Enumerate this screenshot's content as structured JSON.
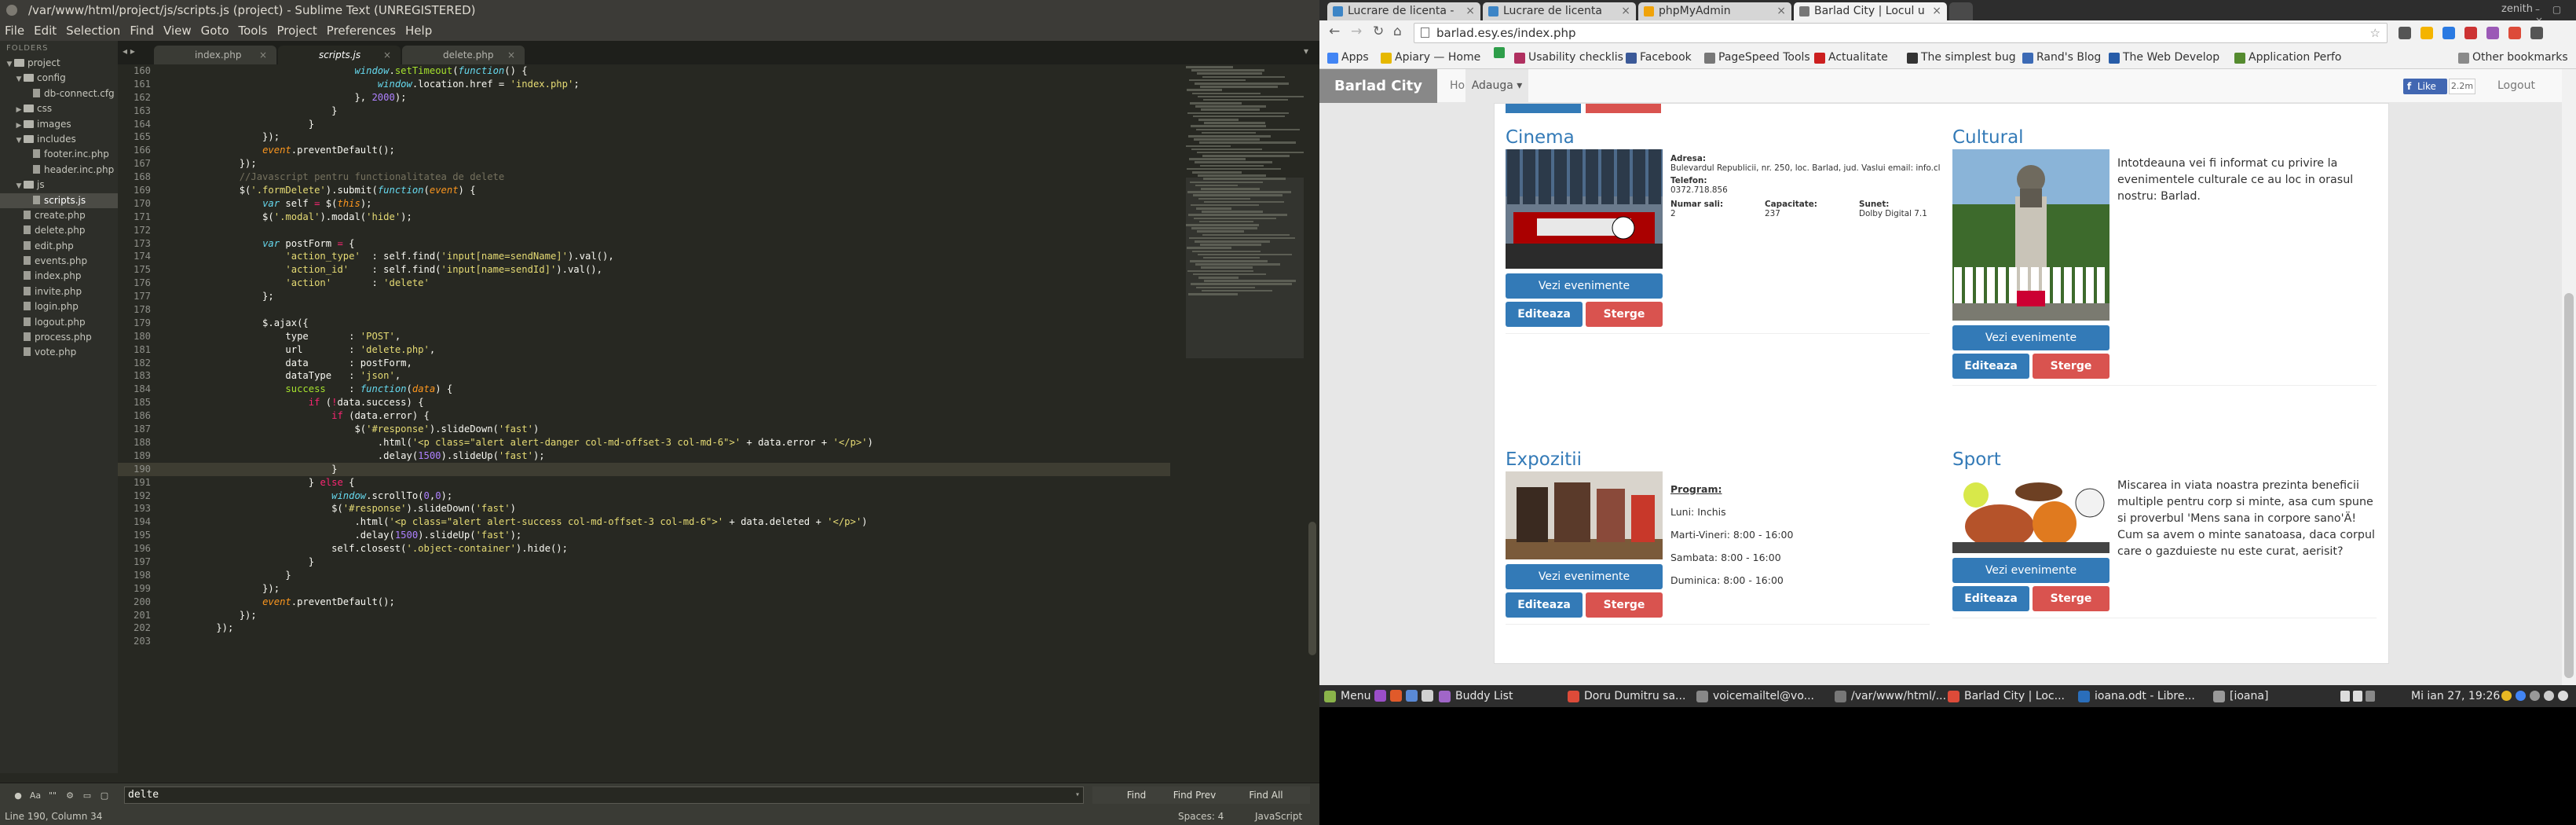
{
  "sublime": {
    "title": "/var/www/html/project/js/scripts.js (project) - Sublime Text (UNREGISTERED)",
    "menu": [
      "File",
      "Edit",
      "Selection",
      "Find",
      "View",
      "Goto",
      "Tools",
      "Project",
      "Preferences",
      "Help"
    ],
    "folders_label": "FOLDERS",
    "tree": [
      {
        "label": "project",
        "depth": 0,
        "kind": "folder",
        "open": true
      },
      {
        "label": "config",
        "depth": 1,
        "kind": "folder",
        "open": true
      },
      {
        "label": "db-connect.cfg",
        "depth": 2,
        "kind": "file"
      },
      {
        "label": "css",
        "depth": 1,
        "kind": "folder",
        "open": false
      },
      {
        "label": "images",
        "depth": 1,
        "kind": "folder",
        "open": false
      },
      {
        "label": "includes",
        "depth": 1,
        "kind": "folder",
        "open": true
      },
      {
        "label": "footer.inc.php",
        "depth": 2,
        "kind": "file"
      },
      {
        "label": "header.inc.php",
        "depth": 2,
        "kind": "file"
      },
      {
        "label": "js",
        "depth": 1,
        "kind": "folder",
        "open": true
      },
      {
        "label": "scripts.js",
        "depth": 2,
        "kind": "file",
        "selected": true
      },
      {
        "label": "create.php",
        "depth": 1,
        "kind": "file"
      },
      {
        "label": "delete.php",
        "depth": 1,
        "kind": "file"
      },
      {
        "label": "edit.php",
        "depth": 1,
        "kind": "file"
      },
      {
        "label": "events.php",
        "depth": 1,
        "kind": "file"
      },
      {
        "label": "index.php",
        "depth": 1,
        "kind": "file"
      },
      {
        "label": "invite.php",
        "depth": 1,
        "kind": "file"
      },
      {
        "label": "login.php",
        "depth": 1,
        "kind": "file"
      },
      {
        "label": "logout.php",
        "depth": 1,
        "kind": "file"
      },
      {
        "label": "process.php",
        "depth": 1,
        "kind": "file"
      },
      {
        "label": "vote.php",
        "depth": 1,
        "kind": "file"
      }
    ],
    "tabs": [
      {
        "label": "index.php"
      },
      {
        "label": "scripts.js",
        "active": true
      },
      {
        "label": "delete.php"
      }
    ],
    "tab_close": "×",
    "tab_nav": "◂ ▸",
    "tab_menu": "▾",
    "code": [
      {
        "n": "160",
        "t": [
          [
            "                            ",
            ""
          ],
          [
            "window",
            "fn"
          ],
          [
            ".",
            ""
          ],
          [
            "setTimeout",
            "id"
          ],
          [
            "(",
            ""
          ],
          [
            "function",
            "fn"
          ],
          [
            "() {",
            ""
          ]
        ]
      },
      {
        "n": "161",
        "t": [
          [
            "                                ",
            ""
          ],
          [
            "window",
            "fn"
          ],
          [
            ".location.href = ",
            ""
          ],
          [
            "'index.php'",
            "st"
          ],
          [
            ";",
            ""
          ]
        ]
      },
      {
        "n": "162",
        "t": [
          [
            "                            }, ",
            ""
          ],
          [
            "2000",
            "nu"
          ],
          [
            ");",
            ""
          ]
        ]
      },
      {
        "n": "163",
        "t": [
          [
            "                        }",
            ""
          ]
        ]
      },
      {
        "n": "164",
        "t": [
          [
            "                    }",
            ""
          ]
        ]
      },
      {
        "n": "165",
        "t": [
          [
            "            });",
            ""
          ]
        ]
      },
      {
        "n": "166",
        "t": [
          [
            "            ",
            ""
          ],
          [
            "event",
            "pa"
          ],
          [
            ".preventDefault();",
            ""
          ]
        ]
      },
      {
        "n": "167",
        "t": [
          [
            "        });",
            ""
          ]
        ]
      },
      {
        "n": "168",
        "t": [
          [
            "        ",
            ""
          ],
          [
            "//Javascript pentru functionalitatea de delete",
            "cm"
          ]
        ]
      },
      {
        "n": "169",
        "t": [
          [
            "        $(",
            ""
          ],
          [
            "'.formDelete'",
            "st"
          ],
          [
            ").submit(",
            ""
          ],
          [
            "function",
            "fn"
          ],
          [
            "(",
            ""
          ],
          [
            "event",
            "pa"
          ],
          [
            ") {",
            ""
          ]
        ]
      },
      {
        "n": "170",
        "t": [
          [
            "            ",
            ""
          ],
          [
            "var",
            "fn"
          ],
          [
            " self ",
            ""
          ],
          [
            "=",
            "kw"
          ],
          [
            " $(",
            ""
          ],
          [
            "this",
            "pa"
          ],
          [
            ");",
            ""
          ]
        ]
      },
      {
        "n": "171",
        "t": [
          [
            "            $(",
            ""
          ],
          [
            "'.modal'",
            "st"
          ],
          [
            ").modal(",
            ""
          ],
          [
            "'hide'",
            "st"
          ],
          [
            ");",
            ""
          ]
        ]
      },
      {
        "n": "172",
        "t": [
          [
            "",
            ""
          ]
        ]
      },
      {
        "n": "173",
        "t": [
          [
            "            ",
            ""
          ],
          [
            "var",
            "fn"
          ],
          [
            " postForm ",
            ""
          ],
          [
            "=",
            "kw"
          ],
          [
            " {",
            ""
          ]
        ]
      },
      {
        "n": "174",
        "t": [
          [
            "                ",
            ""
          ],
          [
            "'action_type'",
            "st"
          ],
          [
            "  : self.find(",
            ""
          ],
          [
            "'input[name=sendName]'",
            "st"
          ],
          [
            ").val(),",
            ""
          ]
        ]
      },
      {
        "n": "175",
        "t": [
          [
            "                ",
            ""
          ],
          [
            "'action_id'",
            "st"
          ],
          [
            "    : self.find(",
            ""
          ],
          [
            "'input[name=sendId]'",
            "st"
          ],
          [
            ").val(),",
            ""
          ]
        ]
      },
      {
        "n": "176",
        "t": [
          [
            "                ",
            ""
          ],
          [
            "'action'",
            "st"
          ],
          [
            "       : ",
            ""
          ],
          [
            "'delete'",
            "st"
          ]
        ]
      },
      {
        "n": "177",
        "t": [
          [
            "            };",
            ""
          ]
        ]
      },
      {
        "n": "178",
        "t": [
          [
            "",
            ""
          ]
        ]
      },
      {
        "n": "179",
        "t": [
          [
            "            $.ajax({",
            ""
          ]
        ]
      },
      {
        "n": "180",
        "t": [
          [
            "                type       : ",
            ""
          ],
          [
            "'POST'",
            "st"
          ],
          [
            ",",
            ""
          ]
        ]
      },
      {
        "n": "181",
        "t": [
          [
            "                url        : ",
            ""
          ],
          [
            "'delete.php'",
            "st"
          ],
          [
            ",",
            ""
          ]
        ]
      },
      {
        "n": "182",
        "t": [
          [
            "                data       : postForm,",
            ""
          ]
        ]
      },
      {
        "n": "183",
        "t": [
          [
            "                dataType   : ",
            ""
          ],
          [
            "'json'",
            "st"
          ],
          [
            ",",
            ""
          ]
        ]
      },
      {
        "n": "184",
        "t": [
          [
            "                ",
            ""
          ],
          [
            "success",
            "id"
          ],
          [
            "    : ",
            ""
          ],
          [
            "function",
            "fn"
          ],
          [
            "(",
            ""
          ],
          [
            "data",
            "pa"
          ],
          [
            ") {",
            ""
          ]
        ]
      },
      {
        "n": "185",
        "t": [
          [
            "                    ",
            ""
          ],
          [
            "if",
            "kw"
          ],
          [
            " (",
            ""
          ],
          [
            "!",
            "kw"
          ],
          [
            "data.success) {",
            ""
          ]
        ]
      },
      {
        "n": "186",
        "t": [
          [
            "                        ",
            ""
          ],
          [
            "if",
            "kw"
          ],
          [
            " (data.error) {",
            ""
          ]
        ]
      },
      {
        "n": "187",
        "t": [
          [
            "                            $(",
            ""
          ],
          [
            "'#response'",
            "st"
          ],
          [
            ").slideDown(",
            ""
          ],
          [
            "'fast'",
            "st"
          ],
          [
            ")",
            ""
          ]
        ]
      },
      {
        "n": "188",
        "t": [
          [
            "                                .html(",
            ""
          ],
          [
            "'<p class=\"alert alert-danger col-md-offset-3 col-md-6\">'",
            "st"
          ],
          [
            " + data.error + ",
            ""
          ],
          [
            "'</p>'",
            "st"
          ],
          [
            ")",
            ""
          ]
        ]
      },
      {
        "n": "189",
        "t": [
          [
            "                                .delay(",
            ""
          ],
          [
            "1500",
            "nu"
          ],
          [
            ").slideUp(",
            ""
          ],
          [
            "'fast'",
            "st"
          ],
          [
            ");",
            ""
          ]
        ]
      },
      {
        "n": "190",
        "t": [
          [
            "                        }",
            ""
          ]
        ],
        "cur": true
      },
      {
        "n": "191",
        "t": [
          [
            "                    } ",
            ""
          ],
          [
            "else",
            "kw"
          ],
          [
            " {",
            ""
          ]
        ]
      },
      {
        "n": "192",
        "t": [
          [
            "                        ",
            ""
          ],
          [
            "window",
            "fn"
          ],
          [
            ".scrollTo(",
            ""
          ],
          [
            "0",
            "nu"
          ],
          [
            ",",
            ""
          ],
          [
            "0",
            "nu"
          ],
          [
            ");",
            ""
          ]
        ]
      },
      {
        "n": "193",
        "t": [
          [
            "                        $(",
            ""
          ],
          [
            "'#response'",
            "st"
          ],
          [
            ").slideDown(",
            ""
          ],
          [
            "'fast'",
            "st"
          ],
          [
            ")",
            ""
          ]
        ]
      },
      {
        "n": "194",
        "t": [
          [
            "                            .html(",
            ""
          ],
          [
            "'<p class=\"alert alert-success col-md-offset-3 col-md-6\">'",
            "st"
          ],
          [
            " + data.deleted + ",
            ""
          ],
          [
            "'</p>'",
            "st"
          ],
          [
            ")",
            ""
          ]
        ]
      },
      {
        "n": "195",
        "t": [
          [
            "                            .delay(",
            ""
          ],
          [
            "1500",
            "nu"
          ],
          [
            ").slideUp(",
            ""
          ],
          [
            "'fast'",
            "st"
          ],
          [
            ");",
            ""
          ]
        ]
      },
      {
        "n": "196",
        "t": [
          [
            "                        self.closest(",
            ""
          ],
          [
            "'.object-container'",
            "st"
          ],
          [
            ").hide();",
            ""
          ]
        ]
      },
      {
        "n": "197",
        "t": [
          [
            "                    }",
            ""
          ]
        ]
      },
      {
        "n": "198",
        "t": [
          [
            "                }",
            ""
          ]
        ]
      },
      {
        "n": "199",
        "t": [
          [
            "            });",
            ""
          ]
        ]
      },
      {
        "n": "200",
        "t": [
          [
            "            ",
            ""
          ],
          [
            "event",
            "pa"
          ],
          [
            ".preventDefault();",
            ""
          ]
        ]
      },
      {
        "n": "201",
        "t": [
          [
            "        });",
            ""
          ]
        ]
      },
      {
        "n": "202",
        "t": [
          [
            "    });",
            ""
          ]
        ]
      },
      {
        "n": "203",
        "t": [
          [
            "",
            ""
          ]
        ]
      }
    ],
    "find_toggles": [
      "●",
      "Aa",
      "\"\"",
      "⚙",
      "▭",
      "▢"
    ],
    "find_value": "delte",
    "find_dd": "▾",
    "find_buttons": [
      "Find",
      "Find Prev",
      "Find All"
    ],
    "status_left": "Line 190, Column 34",
    "status_spaces": "Spaces: 4",
    "status_syntax": "JavaScript"
  },
  "chrome": {
    "tabs": [
      {
        "label": "Lucrare de licenta - ",
        "fav": "#3d85c6"
      },
      {
        "label": "Lucrare de licenta",
        "fav": "#3d85c6"
      },
      {
        "label": "phpMyAdmin",
        "fav": "#f0a30a"
      },
      {
        "label": "Barlad City | Locul u",
        "fav": "#777777",
        "active": true
      }
    ],
    "tab_close": "×",
    "user": "zenith",
    "win_buttons": "– ▢ ×",
    "nav": [
      "←",
      "→",
      "↻",
      "⌂"
    ],
    "url": "barlad.esy.es/index.php",
    "ext_colors": [
      "#555555",
      "#f4b400",
      "#2a7ae2",
      "#cc3333",
      "#9b59b6",
      "#dd4b39",
      "#555555"
    ],
    "bookmarks": [
      {
        "label": "Apps",
        "color": "#4285f4"
      },
      {
        "label": "Apiary — Home",
        "color": "#e6b800"
      },
      {
        "label": "",
        "color": "#2e9e4a"
      },
      {
        "label": "Usability checklis",
        "color": "#b03060"
      },
      {
        "label": "Facebook",
        "color": "#3b5998"
      },
      {
        "label": "PageSpeed Tools",
        "color": "#777777"
      },
      {
        "label": "Actualitate",
        "color": "#cc1f1f"
      },
      {
        "label": "The simplest bug",
        "color": "#333333"
      },
      {
        "label": "Rand's Blog",
        "color": "#3c6ab5"
      },
      {
        "label": "The Web Develop",
        "color": "#275ca8"
      },
      {
        "label": "Application Perfo",
        "color": "#558b2f"
      }
    ],
    "other_bookmarks": "Other bookmarks",
    "page": {
      "brand": "Barlad City",
      "nav_home": "Home",
      "nav_drop": "Adauga ▾",
      "fb_like": "Like",
      "fb_count": "2.2m",
      "logout": "Logout",
      "objects": [
        {
          "title": "Cinema",
          "img": "cinema",
          "desc": [
            {
              "b": "Adresa:",
              "v": "Bulevardul Republicii, nr. 250, loc. Barlad, jud. Vaslui email: info.cl"
            },
            {
              "b": "Telefon:",
              "v": "0372.718.856"
            }
          ],
          "stats": [
            {
              "b": "Numar sali:",
              "v": "2"
            },
            {
              "b": "Capacitate:",
              "v": "237"
            },
            {
              "b": "Sunet:",
              "v": "Dolby Digital 7.1"
            }
          ],
          "btn_events": "Vezi evenimente",
          "btn_edit": "Editeaza",
          "btn_delete": "Sterge"
        },
        {
          "title": "Cultural",
          "img": "cultural",
          "para": "Intotdeauna vei fi informat cu privire la evenimentele culturale ce au loc in orasul nostru: Barlad.",
          "btn_events": "Vezi evenimente",
          "btn_edit": "Editeaza",
          "btn_delete": "Sterge"
        },
        {
          "title": "Expozitii",
          "img": "expo",
          "program_label": "Program:",
          "program": [
            "Luni: Inchis",
            "Marti-Vineri: 8:00 - 16:00",
            "Sambata: 8:00 - 16:00",
            "Duminica: 8:00 - 16:00"
          ],
          "btn_events": "Vezi evenimente",
          "btn_edit": "Editeaza",
          "btn_delete": "Sterge"
        },
        {
          "title": "Sport",
          "img": "sport",
          "para": "Miscarea in viata noastra prezinta beneficii multiple pentru corp si minte, asa cum spune si proverbul 'Mens sana in corpore sano'Ä! Cum sa avem o minte sanatoasa, daca corpul care o gazduieste nu este curat, aerisit?",
          "btn_events": "Vezi evenimente",
          "btn_edit": "Editeaza",
          "btn_delete": "Sterge"
        }
      ]
    }
  },
  "taskbar": {
    "menu": "Menu",
    "items": [
      {
        "label": "Buddy List",
        "color": "#a066c8"
      },
      {
        "label": "Doru Dumitru sa...",
        "color": "#dd4b39"
      },
      {
        "label": "voicemailtel@vo...",
        "color": "#888888"
      },
      {
        "label": "/var/www/html/...",
        "color": "#777777"
      },
      {
        "label": "Barlad City | Loc...",
        "color": "#dd4b39"
      },
      {
        "label": "ioana.odt - Libre...",
        "color": "#2a6ebb"
      },
      {
        "label": "[ioana]",
        "color": "#999999"
      }
    ],
    "clock": "Mi ian 27, 19:26"
  }
}
